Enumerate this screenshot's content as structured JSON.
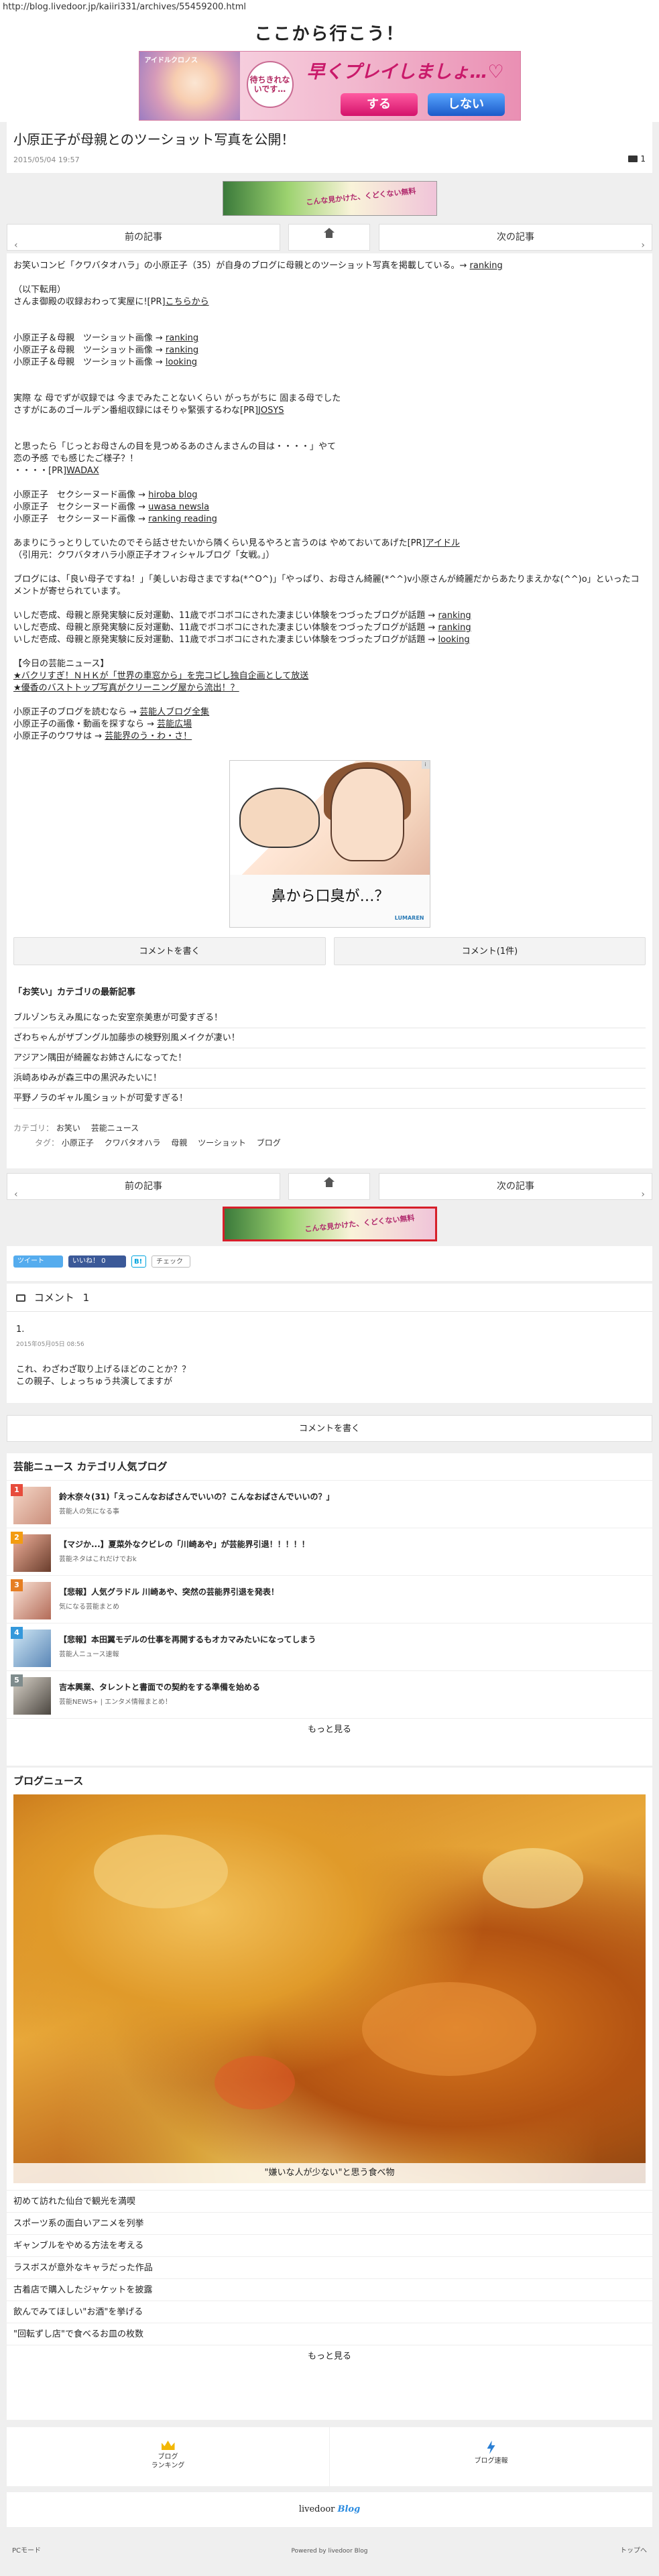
{
  "browser": {
    "url": "http://blog.livedoor.jp/kaiiri331/archives/55459200.html"
  },
  "blog": {
    "title": "ここから行こう！"
  },
  "top_banner": {
    "brand": "アイドルクロノス",
    "bubble": "待ちきれないです…",
    "catch": "早くプレイしましょ…♡",
    "yes": "する",
    "no": "しない"
  },
  "article": {
    "title": "小原正子が母親とのツーショット写真を公開！",
    "date": "2015/05/04 19:57",
    "comment_count": "1"
  },
  "mini_banner": {
    "text": "こんな見かけた、くどくない無料"
  },
  "nav": {
    "prev": "前の記事",
    "next": "次の記事",
    "prev_arrow": "‹",
    "next_arrow": "›"
  },
  "body": {
    "p1_text": "お笑いコンビ「クワバタオハラ」の小原正子（35）が自身のブログに母親とのツーショット写真を掲載している。→ ",
    "p1_link": "ranking",
    "p2a": "（以下転用）",
    "p2b_text": "さんま御殿の収録おわって実屋に![PR]",
    "p2b_link": "こちらから",
    "lines_a": [
      {
        "text": "小原正子＆母親　ツーショット画像 → ",
        "link": "ranking"
      },
      {
        "text": "小原正子＆母親　ツーショット画像 → ",
        "link": "ranking"
      },
      {
        "text": "小原正子＆母親　ツーショット画像 → ",
        "link": "looking"
      }
    ],
    "p3a": "実際 な 母でずが収録では 今までみたことないくらい がっちがちに 固まる母でした",
    "p3b_text": "さすがにあのゴールデン番組収録にはそりゃ緊張するわな[PR]",
    "p3b_link": "JOSYS",
    "p4a": "と思ったら「じっとお母さんの目を見つめるあのさんまさんの目は・・・・」やて",
    "p4b": "恋の予感 でも感じたご様子？！",
    "p4c_text": "・・・・[PR]",
    "p4c_link": "WADAX",
    "lines_b": [
      {
        "text": "小原正子　セクシーヌード画像 → ",
        "link": "hiroba blog"
      },
      {
        "text": "小原正子　セクシーヌード画像 → ",
        "link": "uwasa newsla"
      },
      {
        "text": "小原正子　セクシーヌード画像 → ",
        "link": "ranking reading"
      }
    ],
    "p5a_text": "あまりにうっとりしていたのでそら話させたいから隣くらい見るやろと言うのは やめておいてあげた[PR]",
    "p5a_link": "アイドル",
    "p5b": "（引用元：クワバタオハラ小原正子オフィシャルブログ「女戦。」）",
    "p6a": "ブログには、「良い母子ですね！」「美しいお母さまですね(*^O^)」「やっぱり、お母さん綺麗(*^^)v小原さんが綺麗だからあたりまえかな(^^)o」といったコメントが寄せられています。",
    "lines_c": [
      {
        "text": "いしだ壱成、母親と原発実験に反対運動、11歳でボコボコにされた凄まじい体験をつづったブログが話題 → ",
        "link": "ranking"
      },
      {
        "text": "いしだ壱成、母親と原発実験に反対運動、11歳でボコボコにされた凄まじい体験をつづったブログが話題 → ",
        "link": "ranking"
      },
      {
        "text": "いしだ壱成、母親と原発実験に反対運動、11歳でボコボコにされた凄まじい体験をつづったブログが話題 → ",
        "link": "looking"
      }
    ],
    "news_head": "【今日の芸能ニュース】",
    "news_1": "★バクリすぎ！ＮＨＫが「世界の車窓から」を完コピし独自企画として放送",
    "news_2": "★優香のバストトップ写真がクリーニング屋から流出！？",
    "lines_d": [
      {
        "text": "小原正子のブログを読むなら → ",
        "link": "芸能人ブログ全集"
      },
      {
        "text": "小原正子の画像・動画を探すなら → ",
        "link": "芸能広場"
      },
      {
        "text": "小原正子のウワサは → ",
        "link": "芸能界のう・わ・さ！"
      }
    ]
  },
  "ad": {
    "caption": "鼻から口臭が…？",
    "logo": "LUMAREN",
    "tag": "i"
  },
  "comment_buttons": {
    "write": "コメントを書く",
    "count": "コメント(1件)"
  },
  "related": {
    "title": "「お笑い」カテゴリの最新記事",
    "items": [
      "ブルゾンちえみ風になった安室奈美恵が可愛すぎる！",
      "ざわちゃんがザブングル加藤歩の検野別風メイクが凄い！",
      "アジアン隅田が綺麗なお姉さんになってた！",
      "浜崎あゆみが森三中の黒沢みたいに！",
      "平野ノラのギャル風ショットが可愛すぎる！"
    ]
  },
  "tags": {
    "category_label": "カテゴリ：",
    "categories": [
      "お笑い",
      "芸能ニュース"
    ],
    "tag_label": "タグ：",
    "tags": [
      "小原正子",
      "クワバタオハラ",
      "母親",
      "ツーショット",
      "ブログ"
    ]
  },
  "share": {
    "tweet": "ツイート",
    "like": "いいね！ 0",
    "hatena": "B!",
    "check": "チェック"
  },
  "comments": {
    "title": "コメント",
    "count": "1",
    "items": [
      {
        "num": "1.",
        "meta": "2015年05月05日 08:56",
        "line1": "これ、わざわざ取り上げるほどのことか？？",
        "line2": "この親子、しょっちゅう共演してますが"
      }
    ]
  },
  "write_comment": "コメントを書く",
  "ranking": {
    "title": "芸能ニュース カテゴリ人気ブログ",
    "items": [
      {
        "num": "1",
        "title": "鈴木奈々(31)「えっこんなおばさんでいいの？こんなおばさんでいいの？」",
        "sub": "芸能人の気になる事"
      },
      {
        "num": "2",
        "title": "【マジか...】夏菜外なクビレの「川崎あや」が芸能界引退！！！！！",
        "sub": "芸能ネタはこれだけでおk"
      },
      {
        "num": "3",
        "title": "【悲報】人気グラドル 川崎あや、突然の芸能界引退を発表！",
        "sub": "気になる芸能まとめ"
      },
      {
        "num": "4",
        "title": "【悲報】本田翼モデルの仕事を再開するもオカマみたいになってしまう",
        "sub": "芸能人ニュース速報"
      },
      {
        "num": "5",
        "title": "吉本興業、タレントと書面での契約をする準備を始める",
        "sub": "芸能NEWS+ | エンタメ情報まとめ！"
      }
    ],
    "more": "もっと見る"
  },
  "blog_news": {
    "title": "ブログニュース",
    "caption": "\"嫌いな人が少ない\"と思う食べ物",
    "items": [
      "初めて訪れた仙台で観光を満喫",
      "スポーツ系の面白いアニメを列挙",
      "ギャンブルをやめる方法を考える",
      "ラスボスが意外なキャラだった作品",
      "古着店で購入したジャケットを披露",
      "飲んでみてほしい\"お酒\"を挙げる",
      "\"回転ずし店\"で食べるお皿の枚数"
    ],
    "more": "もっと見る"
  },
  "footer": {
    "ranking_l1": "ブログ",
    "ranking_l2": "ランキング",
    "flash": "ブログ速報",
    "logo_a": "livedoor",
    "logo_b": "Blog",
    "pc": "PCモード",
    "powered": "Powered by livedoor Blog",
    "top": "トップへ"
  }
}
